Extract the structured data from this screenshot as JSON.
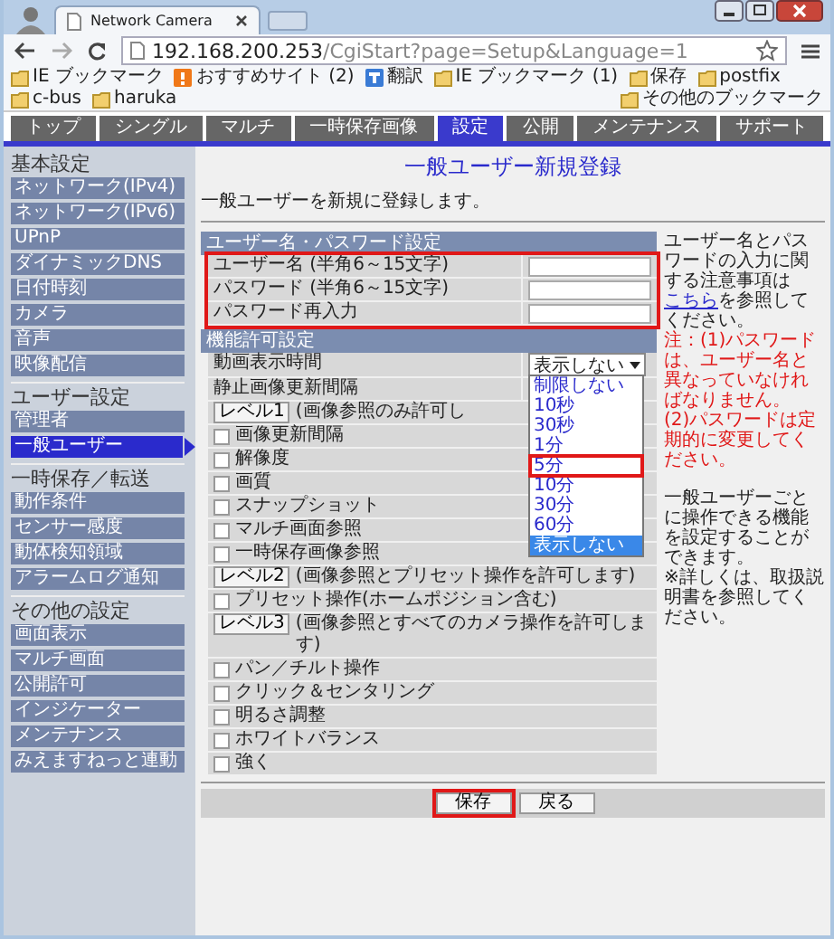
{
  "browser": {
    "tab_title": "Network Camera",
    "url_host": "192.168.200.253",
    "url_path": "/CgiStart?page=Setup&Language=1",
    "bookmarks": [
      {
        "label": "IE ブックマーク",
        "kind": "folder"
      },
      {
        "label": "おすすめサイト (2)",
        "kind": "site"
      },
      {
        "label": "翻訳",
        "kind": "translate"
      },
      {
        "label": "IE ブックマーク (1)",
        "kind": "folder"
      },
      {
        "label": "保存",
        "kind": "folder"
      },
      {
        "label": "postfix",
        "kind": "folder"
      },
      {
        "label": "c-bus",
        "kind": "folder"
      },
      {
        "label": "haruka",
        "kind": "folder"
      },
      {
        "label": "その他のブックマーク",
        "kind": "folder"
      }
    ]
  },
  "nav_tabs": [
    {
      "label": "トップ",
      "selected": false
    },
    {
      "label": "シングル",
      "selected": false
    },
    {
      "label": "マルチ",
      "selected": false
    },
    {
      "label": "一時保存画像",
      "selected": false
    },
    {
      "label": "設定",
      "selected": true
    },
    {
      "label": "公開",
      "selected": false
    },
    {
      "label": "メンテナンス",
      "selected": false
    },
    {
      "label": "サポート",
      "selected": false
    }
  ],
  "sidebar": [
    {
      "heading": "基本設定",
      "items": [
        {
          "label": "ネットワーク(IPv4)",
          "selected": false
        },
        {
          "label": "ネットワーク(IPv6)",
          "selected": false
        },
        {
          "label": "UPnP",
          "selected": false
        },
        {
          "label": "ダイナミックDNS",
          "selected": false
        },
        {
          "label": "日付時刻",
          "selected": false
        },
        {
          "label": "カメラ",
          "selected": false
        },
        {
          "label": "音声",
          "selected": false
        },
        {
          "label": "映像配信",
          "selected": false
        }
      ]
    },
    {
      "heading": "ユーザー設定",
      "items": [
        {
          "label": "管理者",
          "selected": false
        },
        {
          "label": "一般ユーザー",
          "selected": true
        }
      ]
    },
    {
      "heading": "一時保存／転送",
      "items": [
        {
          "label": "動作条件",
          "selected": false
        },
        {
          "label": "センサー感度",
          "selected": false
        },
        {
          "label": "動体検知領域",
          "selected": false
        },
        {
          "label": "アラームログ通知",
          "selected": false
        }
      ]
    },
    {
      "heading": "その他の設定",
      "items": [
        {
          "label": "画面表示",
          "selected": false
        },
        {
          "label": "マルチ画面",
          "selected": false
        },
        {
          "label": "公開許可",
          "selected": false
        },
        {
          "label": "インジケーター",
          "selected": false
        },
        {
          "label": "メンテナンス",
          "selected": false
        },
        {
          "label": "みえますねっと連動",
          "selected": false
        }
      ]
    }
  ],
  "page": {
    "title": "一般ユーザー新規登録",
    "description": "一般ユーザーを新規に登録します。"
  },
  "sections": [
    {
      "heading": "ユーザー名・パスワード設定",
      "highlighted": true,
      "rows": [
        {
          "kind": "text_input",
          "label": "ユーザー名 (半角6～15文字)"
        },
        {
          "kind": "text_input",
          "label": "パスワード (半角6～15文字)"
        },
        {
          "kind": "text_input",
          "label": "パスワード再入力"
        }
      ]
    },
    {
      "heading": "機能許可設定",
      "highlighted": false,
      "rows": [
        {
          "kind": "select",
          "label": "動画表示時間",
          "value": "表示しない",
          "expanded": true,
          "options": [
            {
              "label": "制限しない",
              "selected": false,
              "highlighted": false
            },
            {
              "label": "10秒",
              "selected": false,
              "highlighted": false
            },
            {
              "label": "30秒",
              "selected": false,
              "highlighted": false
            },
            {
              "label": "1分",
              "selected": false,
              "highlighted": false
            },
            {
              "label": "5分",
              "selected": false,
              "highlighted": true
            },
            {
              "label": "10分",
              "selected": false,
              "highlighted": false
            },
            {
              "label": "30分",
              "selected": false,
              "highlighted": false
            },
            {
              "label": "60分",
              "selected": false,
              "highlighted": false
            },
            {
              "label": "表示しない",
              "selected": true,
              "highlighted": false
            }
          ]
        },
        {
          "kind": "label",
          "label": "静止画像更新間隔"
        },
        {
          "kind": "level",
          "button": "レベル1",
          "text": "(画像参照のみ許可し"
        },
        {
          "kind": "checkbox",
          "label": "画像更新間隔",
          "checked": false
        },
        {
          "kind": "checkbox",
          "label": "解像度",
          "checked": false
        },
        {
          "kind": "checkbox",
          "label": "画質",
          "checked": false
        },
        {
          "kind": "checkbox",
          "label": "スナップショット",
          "checked": false
        },
        {
          "kind": "checkbox",
          "label": "マルチ画面参照",
          "checked": false
        },
        {
          "kind": "checkbox",
          "label": "一時保存画像参照",
          "checked": false
        },
        {
          "kind": "level",
          "button": "レベル2",
          "text": "(画像参照とプリセット操作を許可します)"
        },
        {
          "kind": "checkbox",
          "label": "プリセット操作(ホームポジション含む)",
          "checked": false
        },
        {
          "kind": "level",
          "button": "レベル3",
          "text": "(画像参照とすべてのカメラ操作を許可します)"
        },
        {
          "kind": "checkbox",
          "label": "パン／チルト操作",
          "checked": false
        },
        {
          "kind": "checkbox",
          "label": "クリック＆センタリング",
          "checked": false
        },
        {
          "kind": "checkbox",
          "label": "明るさ調整",
          "checked": false
        },
        {
          "kind": "checkbox",
          "label": "ホワイトバランス",
          "checked": false
        },
        {
          "kind": "checkbox",
          "label": "強く",
          "checked": false
        }
      ]
    }
  ],
  "notes": [
    {
      "paragraphs": [
        {
          "color": "#222222",
          "segments": [
            {
              "kind": "plain",
              "text": "ユーザー名とパスワードの入力に関する注意事項は"
            },
            {
              "kind": "link",
              "text": "こちら"
            },
            {
              "kind": "plain",
              "text": "を参照してください。"
            }
          ]
        },
        {
          "color": "#e01818",
          "segments": [
            {
              "kind": "plain",
              "text": "注：(1)パスワードは、ユーザー名と異なっていなければなりません。"
            }
          ]
        },
        {
          "color": "#e01818",
          "segments": [
            {
              "kind": "plain",
              "text": "(2)パスワードは定期的に変更してください。"
            }
          ]
        }
      ]
    },
    {
      "paragraphs": [
        {
          "color": "#222222",
          "segments": [
            {
              "kind": "plain",
              "text": "一般ユーザーごとに操作できる機能を設定することができます。"
            }
          ]
        },
        {
          "color": "#222222",
          "segments": [
            {
              "kind": "plain",
              "text": "※詳しくは、取扱説明書を参照してください。"
            }
          ]
        }
      ]
    }
  ],
  "buttons": [
    {
      "label": "保存",
      "highlighted": true
    },
    {
      "label": "戻る",
      "highlighted": false
    }
  ]
}
